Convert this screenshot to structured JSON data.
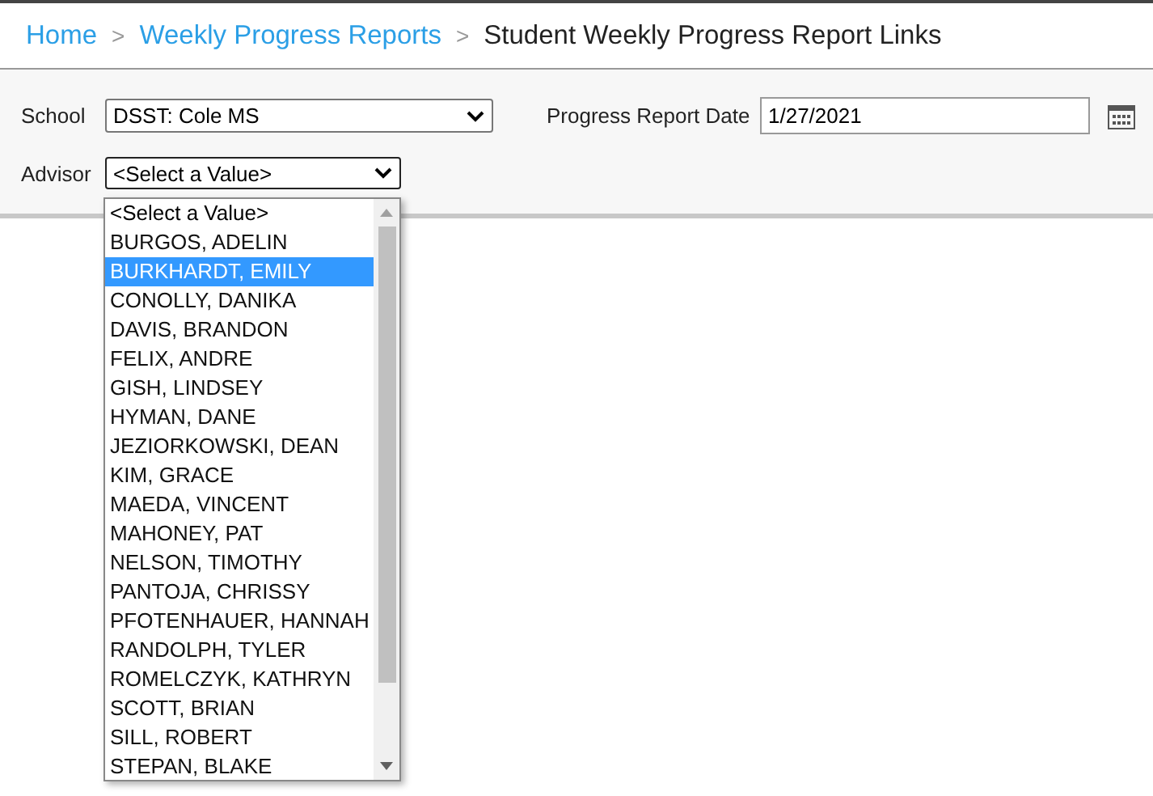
{
  "breadcrumb": [
    {
      "label": "Home",
      "kind": "link"
    },
    {
      "label": "Weekly Progress Reports",
      "kind": "link"
    },
    {
      "label": "Student Weekly Progress Report Links",
      "kind": "current"
    }
  ],
  "separator": ">",
  "school": {
    "label": "School",
    "value": "DSST: Cole MS"
  },
  "report_date": {
    "label": "Progress Report Date",
    "value": "1/27/2021"
  },
  "advisor": {
    "label": "Advisor",
    "value": "<Select a Value>",
    "expanded": true,
    "options": [
      {
        "label": "<Select a Value>",
        "selected": true,
        "highlighted": false
      },
      {
        "label": "BURGOS, ADELIN",
        "selected": false
      },
      {
        "label": "BURKHARDT, EMILY",
        "selected": false,
        "highlighted": true
      },
      {
        "label": "CONOLLY, DANIKA",
        "selected": false
      },
      {
        "label": "DAVIS, BRANDON",
        "selected": false
      },
      {
        "label": "FELIX, ANDRE",
        "selected": false
      },
      {
        "label": "GISH, LINDSEY",
        "selected": false
      },
      {
        "label": "HYMAN, DANE",
        "selected": false
      },
      {
        "label": "JEZIORKOWSKI, DEAN",
        "selected": false
      },
      {
        "label": "KIM, GRACE",
        "selected": false
      },
      {
        "label": "MAEDA, VINCENT",
        "selected": false
      },
      {
        "label": "MAHONEY, PAT",
        "selected": false
      },
      {
        "label": "NELSON, TIMOTHY",
        "selected": false
      },
      {
        "label": "PANTOJA, CHRISSY",
        "selected": false
      },
      {
        "label": "PFOTENHAUER, HANNAH",
        "selected": false
      },
      {
        "label": "RANDOLPH, TYLER",
        "selected": false
      },
      {
        "label": "ROMELCZYK, KATHRYN",
        "selected": false
      },
      {
        "label": "SCOTT, BRIAN",
        "selected": false
      },
      {
        "label": "SILL, ROBERT",
        "selected": false
      },
      {
        "label": "STEPAN, BLAKE",
        "selected": false
      }
    ]
  }
}
